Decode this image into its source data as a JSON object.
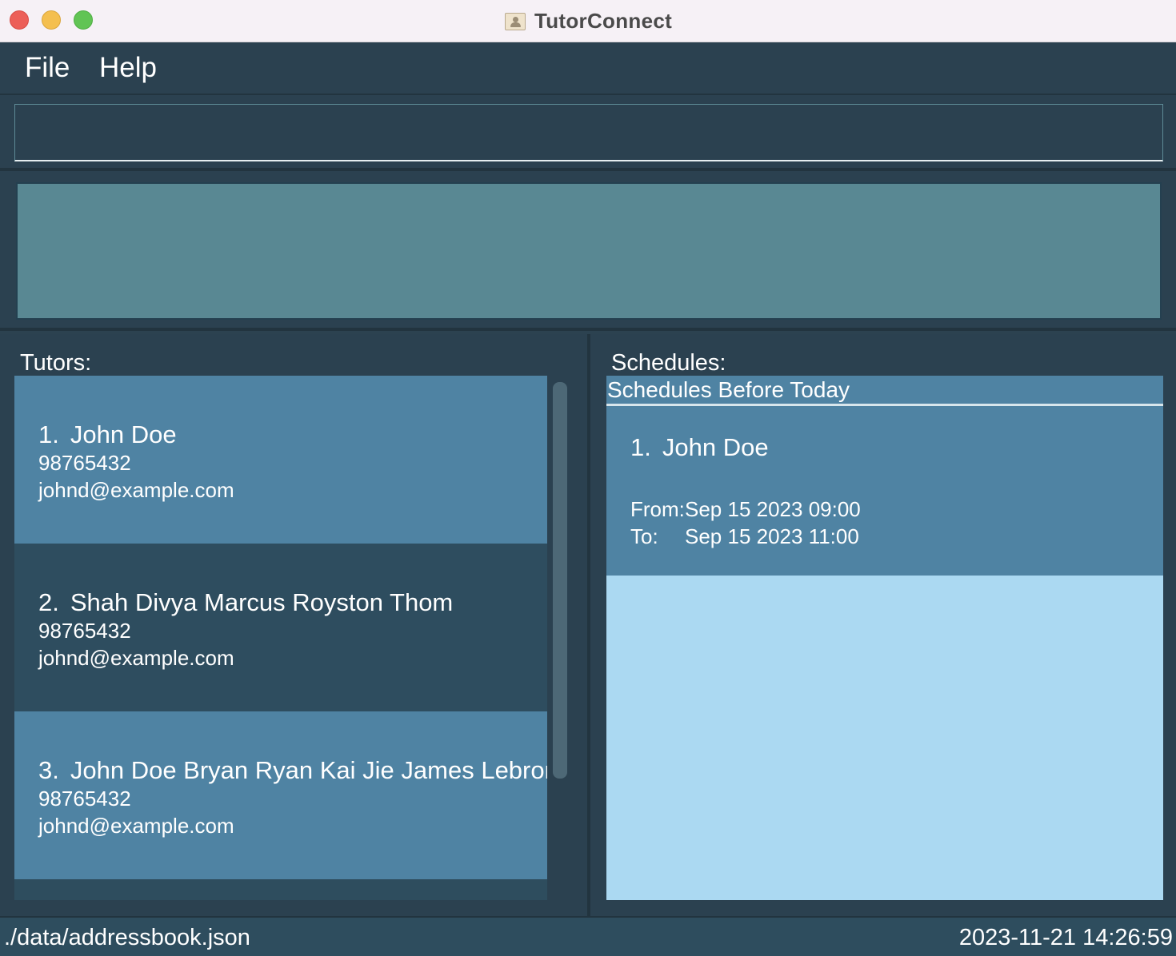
{
  "window": {
    "title": "TutorConnect",
    "icon": "app-contact-icon"
  },
  "menu": {
    "file": "File",
    "help": "Help"
  },
  "command": {
    "value": "",
    "placeholder": ""
  },
  "result": {
    "text": ""
  },
  "tutors": {
    "label": "Tutors:",
    "items": [
      {
        "index": "1.",
        "name": "John Doe",
        "phone": "98765432",
        "email": "johnd@example.com"
      },
      {
        "index": "2.",
        "name": "Shah Divya Marcus Royston Thom",
        "phone": "98765432",
        "email": "johnd@example.com"
      },
      {
        "index": "3.",
        "name": "John Doe Bryan Ryan Kai Jie James Lebron",
        "phone": "98765432",
        "email": "johnd@example.com"
      }
    ]
  },
  "schedules": {
    "label": "Schedules:",
    "section_header": "Schedules Before Today",
    "items": [
      {
        "index": "1.",
        "name": "John Doe",
        "from_label": "From:",
        "from": "Sep 15 2023 09:00",
        "to_label": "To:",
        "to": "Sep 15 2023 11:00"
      }
    ]
  },
  "status": {
    "path": "./data/addressbook.json",
    "timestamp": "2023-11-21 14:26:59"
  },
  "colors": {
    "background": "#2b4150",
    "card_highlight": "#4f83a3",
    "card_dark": "#2e4d5f",
    "result_box": "#598893",
    "schedule_empty": "#abd9f2"
  }
}
